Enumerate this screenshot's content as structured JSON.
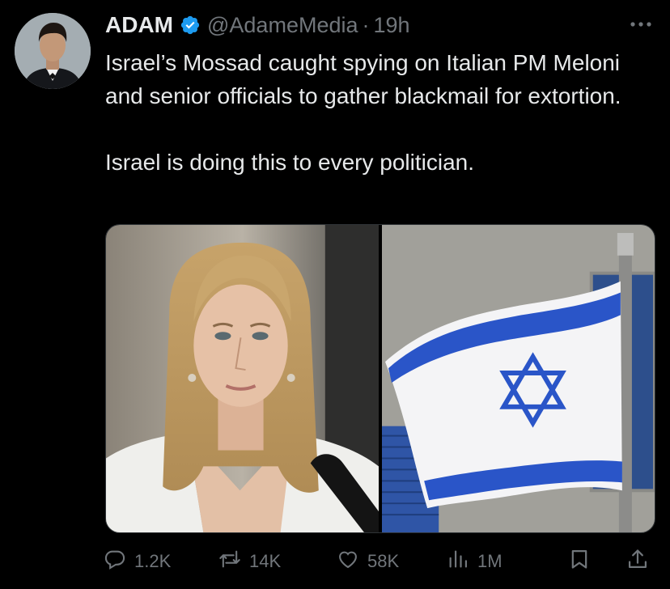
{
  "tweet": {
    "author_name": "ADAM",
    "handle": "@AdameMedia",
    "separator": "·",
    "time": "19h",
    "text_para_1": "Israel’s Mossad caught spying on Italian PM Meloni and senior officials to gather blackmail for extortion.",
    "text_para_2": "Israel is doing this to every politician."
  },
  "actions": {
    "reply_count": "1.2K",
    "retweet_count": "14K",
    "like_count": "58K",
    "views_count": "1M"
  },
  "icons": {
    "verified": "verified-badge-icon",
    "more": "more-dots-icon",
    "reply": "reply-icon",
    "retweet": "retweet-icon",
    "like": "heart-icon",
    "views": "views-bar-icon",
    "bookmark": "bookmark-icon",
    "share": "share-icon"
  },
  "colors": {
    "background": "#000000",
    "text": "#e7e9ea",
    "secondary": "#71767b",
    "verified": "#1d9bf0",
    "flag_blue": "#2a55c8"
  }
}
